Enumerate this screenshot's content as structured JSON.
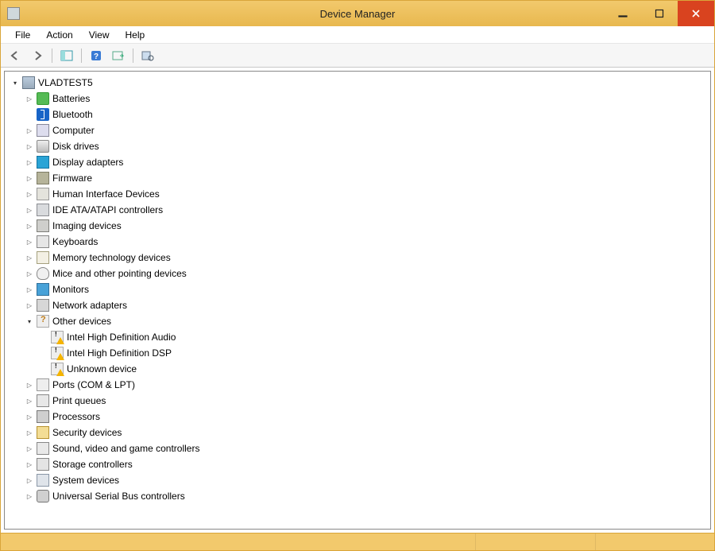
{
  "window": {
    "title": "Device Manager"
  },
  "menu": {
    "file": "File",
    "action": "Action",
    "view": "View",
    "help": "Help"
  },
  "toolbar": {
    "back": "Back",
    "forward": "Forward",
    "properties_pane": "Show/Hide Console Tree",
    "help": "Help",
    "scan": "Scan for hardware changes",
    "detail": "View"
  },
  "tree": {
    "root": {
      "label": "VLADTEST5",
      "icon": "computer",
      "expanded": true
    },
    "items": [
      {
        "label": "Batteries",
        "icon": "battery",
        "hasChildren": true
      },
      {
        "label": "Bluetooth",
        "icon": "bluetooth",
        "hasChildren": false
      },
      {
        "label": "Computer",
        "icon": "pc",
        "hasChildren": true
      },
      {
        "label": "Disk drives",
        "icon": "disk",
        "hasChildren": true
      },
      {
        "label": "Display adapters",
        "icon": "display",
        "hasChildren": true
      },
      {
        "label": "Firmware",
        "icon": "firmware",
        "hasChildren": true
      },
      {
        "label": "Human Interface Devices",
        "icon": "hid",
        "hasChildren": true
      },
      {
        "label": "IDE ATA/ATAPI controllers",
        "icon": "ide",
        "hasChildren": true
      },
      {
        "label": "Imaging devices",
        "icon": "imaging",
        "hasChildren": true
      },
      {
        "label": "Keyboards",
        "icon": "keyboard",
        "hasChildren": true
      },
      {
        "label": "Memory technology devices",
        "icon": "memory",
        "hasChildren": true
      },
      {
        "label": "Mice and other pointing devices",
        "icon": "mouse",
        "hasChildren": true
      },
      {
        "label": "Monitors",
        "icon": "monitor",
        "hasChildren": true
      },
      {
        "label": "Network adapters",
        "icon": "network",
        "hasChildren": true
      },
      {
        "label": "Other devices",
        "icon": "other",
        "hasChildren": true,
        "expanded": true,
        "children": [
          {
            "label": "Intel High Definition Audio",
            "icon": "other",
            "warning": true
          },
          {
            "label": "Intel High Definition DSP",
            "icon": "other",
            "warning": true
          },
          {
            "label": "Unknown device",
            "icon": "other",
            "warning": true
          }
        ]
      },
      {
        "label": "Ports (COM & LPT)",
        "icon": "ports",
        "hasChildren": true
      },
      {
        "label": "Print queues",
        "icon": "print",
        "hasChildren": true
      },
      {
        "label": "Processors",
        "icon": "cpu",
        "hasChildren": true
      },
      {
        "label": "Security devices",
        "icon": "security",
        "hasChildren": true
      },
      {
        "label": "Sound, video and game controllers",
        "icon": "sound",
        "hasChildren": true
      },
      {
        "label": "Storage controllers",
        "icon": "storage",
        "hasChildren": true
      },
      {
        "label": "System devices",
        "icon": "system",
        "hasChildren": true
      },
      {
        "label": "Universal Serial Bus controllers",
        "icon": "usb",
        "hasChildren": true
      }
    ]
  }
}
